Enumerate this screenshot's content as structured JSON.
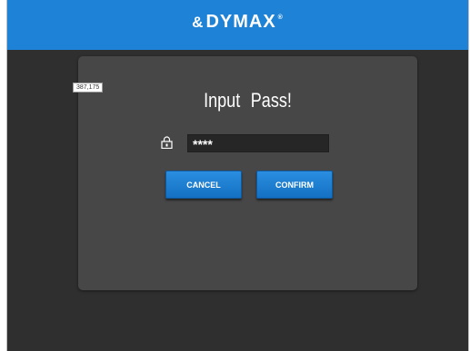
{
  "header": {
    "brand": "DYMAX",
    "brand_mark": "&",
    "brand_reg": "®",
    "color": "#1e82d6"
  },
  "coord_badge": "387,175",
  "dialog": {
    "title": "Input Pass!",
    "password_value": "****",
    "cancel_label": "CANCEL",
    "confirm_label": "CONFIRM",
    "lock_icon": "padlock-icon"
  }
}
